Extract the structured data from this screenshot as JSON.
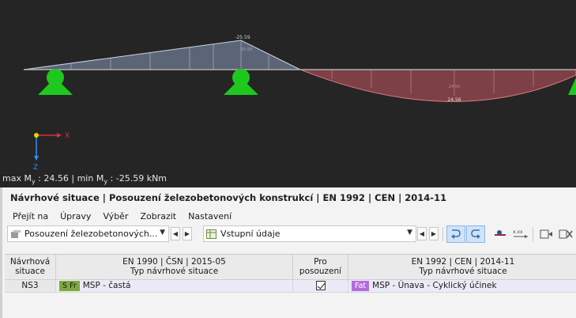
{
  "viewport": {
    "peak_negative_label": "-25.59",
    "peak_negative_inner_label": "-25.59",
    "peak_positive_label": "24.56",
    "peak_positive_inner_label": "24.56",
    "axis_x_label": "X",
    "axis_z_label": "Z",
    "caption_max_prefix": "max M",
    "caption_subscript": "y",
    "caption_max_value": " : 24.56 | min M",
    "caption_min_value": " : -25.59 kNm",
    "colors": {
      "background": "#252526",
      "negative_fill": "#8a9ab8",
      "positive_fill": "#9a4a52",
      "support": "#1ec81e"
    }
  },
  "panel": {
    "title": "Návrhové situace | Posouzení železobetonových konstrukcí | EN 1992 | CEN | 2014-11",
    "menu": [
      "Přejít na",
      "Úpravy",
      "Výběr",
      "Zobrazit",
      "Nastavení"
    ],
    "toolbar": {
      "module_combo": "Posouzení železobetonových...",
      "table_combo": "Vstupní údaje",
      "icons": [
        "module-icon",
        "nav-prev-icon",
        "nav-next-icon",
        "table-icon",
        "undo-icon",
        "redo-icon",
        "pen-icon",
        "numbering-icon",
        "paste-icon",
        "delete-column-icon"
      ]
    },
    "table": {
      "headers": {
        "col1_line1": "Návrhová",
        "col1_line2": "situace",
        "col2_line1": "EN 1990 | ČSN | 2015-05",
        "col2_line2": "Typ návrhové situace",
        "col3_line1": "Pro",
        "col3_line2": "posouzení",
        "col4_line1": "EN 1992 | CEN | 2014-11",
        "col4_line2": "Typ návrhové situace"
      },
      "rows": [
        {
          "id": "NS3",
          "type_badge": "S Fr",
          "type_badge_color": "#7fa93f",
          "type_label": "MSP - častá",
          "checked": true,
          "design_badge": "Fat",
          "design_badge_color": "#b46ae0",
          "design_label": "MSP - Únava - Cyklický účinek"
        }
      ]
    }
  }
}
